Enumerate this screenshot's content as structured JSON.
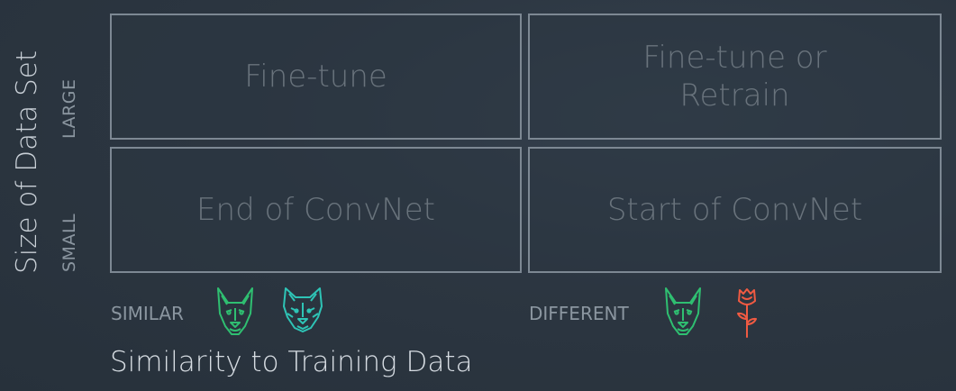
{
  "quadrants": {
    "large_similar": "Fine-tune",
    "large_different": "Fine-tune or Retrain",
    "small_similar": "End of ConvNet",
    "small_different": "Start of ConvNet"
  },
  "y_axis": {
    "title": "Size of Data Set",
    "large_label": "LARGE",
    "small_label": "SMALL"
  },
  "x_axis": {
    "title": "Similarity to Training Data",
    "similar_label": "SIMILAR",
    "different_label": "DIFFERENT"
  },
  "icons": {
    "similar": [
      "dog-icon",
      "wolf-icon"
    ],
    "different": [
      "dog-icon",
      "rose-icon"
    ]
  },
  "colors": {
    "background": "#2c3641",
    "grid_border": "#7d8893",
    "dog": "#2fbf71",
    "wolf": "#2ec4b6",
    "rose": "#f05a42"
  }
}
